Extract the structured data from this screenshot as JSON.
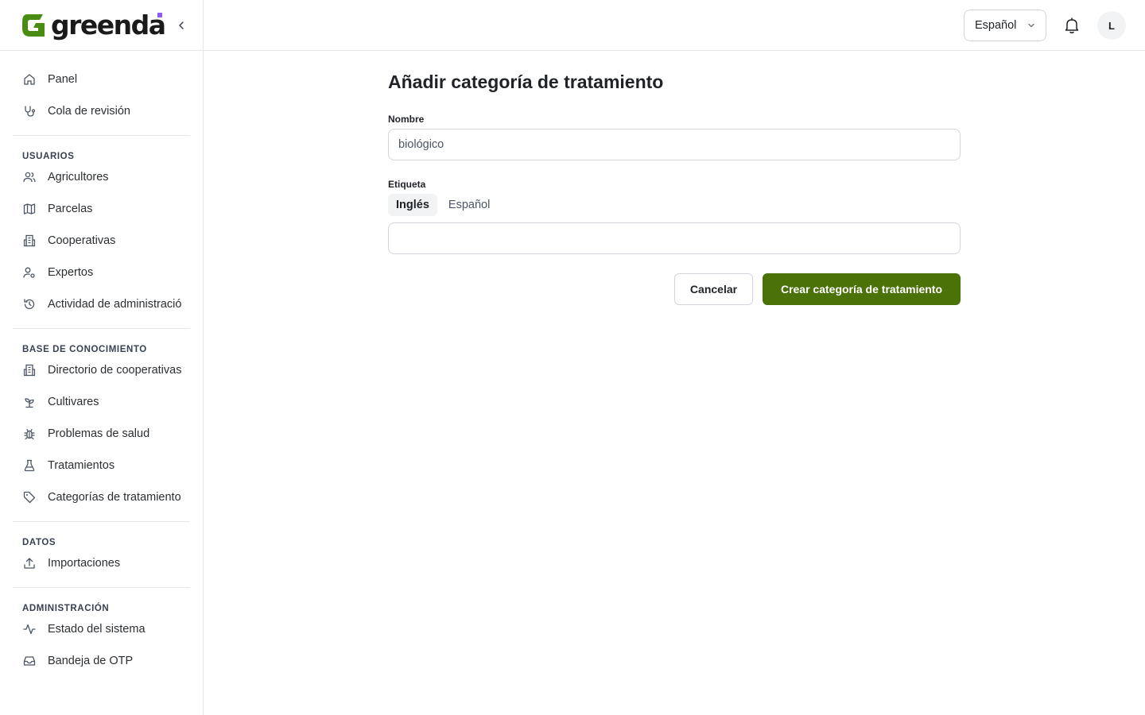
{
  "brand": {
    "name": "greenda",
    "accent": "#4a7208",
    "dot_color": "#8b5cf6"
  },
  "sidebar": {
    "top_items": [
      {
        "label": "Panel",
        "icon": "home-icon"
      },
      {
        "label": "Cola de revisión",
        "icon": "stethoscope-icon"
      }
    ],
    "sections": [
      {
        "title": "USUARIOS",
        "items": [
          {
            "label": "Agricultores",
            "icon": "users-icon"
          },
          {
            "label": "Parcelas",
            "icon": "map-icon"
          },
          {
            "label": "Cooperativas",
            "icon": "building-icon"
          },
          {
            "label": "Expertos",
            "icon": "user-cog-icon"
          },
          {
            "label": "Actividad de administración",
            "icon": "history-icon"
          }
        ]
      },
      {
        "title": "BASE DE CONOCIMIENTO",
        "items": [
          {
            "label": "Directorio de cooperativas",
            "icon": "building-icon"
          },
          {
            "label": "Cultivares",
            "icon": "sprout-icon"
          },
          {
            "label": "Problemas de salud",
            "icon": "bug-icon"
          },
          {
            "label": "Tratamientos",
            "icon": "flask-icon"
          },
          {
            "label": "Categorías de tratamiento",
            "icon": "tag-icon"
          }
        ]
      },
      {
        "title": "DATOS",
        "items": [
          {
            "label": "Importaciones",
            "icon": "upload-icon"
          }
        ]
      },
      {
        "title": "ADMINISTRACIÓN",
        "items": [
          {
            "label": "Estado del sistema",
            "icon": "activity-icon"
          },
          {
            "label": "Bandeja de OTP",
            "icon": "inbox-icon"
          }
        ]
      }
    ]
  },
  "topbar": {
    "language": "Español",
    "avatar_initial": "L"
  },
  "form": {
    "title": "Añadir categoría de tratamiento",
    "name_label": "Nombre",
    "name_value": "biológico",
    "label_label": "Etiqueta",
    "tabs": [
      "Inglés",
      "Español"
    ],
    "active_tab": "Inglés",
    "label_value": "",
    "cancel_label": "Cancelar",
    "submit_label": "Crear categoría de tratamiento"
  }
}
